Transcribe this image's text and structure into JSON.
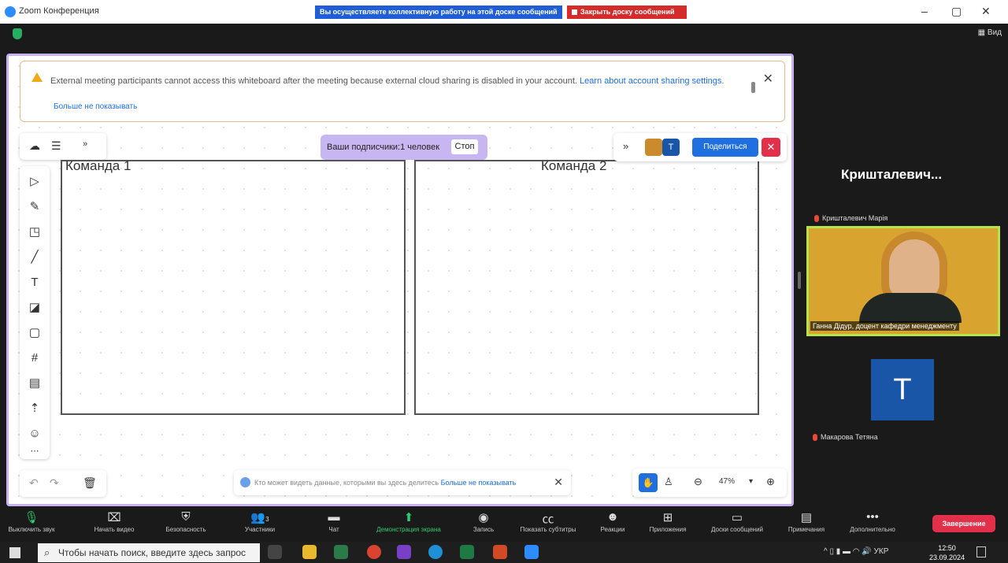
{
  "window": {
    "title": "Zoom Конференция",
    "collab_banner": "Вы осуществляете коллективную работу на этой доске сообщений",
    "close_board": "Закрыть доску сообщений",
    "view_label": "Вид"
  },
  "notice": {
    "message": "External meeting participants cannot access this whiteboard after the meeting because external cloud sharing is disabled in your account.",
    "link": "Learn about account sharing settings.",
    "dont_show": "Больше не показывать"
  },
  "board": {
    "frame1": "Команда 1",
    "frame2": "Команда 2",
    "subscribers": "Ваши подписчики:1 человек",
    "stop": "Стоп",
    "share": "Поделиться",
    "avatar_t": "T",
    "privacy_text": "Кто может видеть данные, которыми вы здесь делитесь",
    "privacy_link": "Больше не показывать",
    "zoom_level": "47%"
  },
  "participants": {
    "speaker_big": "Кришталевич...",
    "speaker_sub": "Кришталевич Марія",
    "video_caption": "Ганна Дідур, доцент кафедри менеджменту",
    "avatar_letter": "T",
    "third_name": "Макарова Тетяна"
  },
  "toolbar": {
    "mute": "Выключить звук",
    "video": "Начать видео",
    "security": "Безопасность",
    "participants": "Участники",
    "participants_count": "3",
    "chat": "Чат",
    "share_screen": "Демонстрация экрана",
    "record": "Запись",
    "captions": "Показать субтитры",
    "reactions": "Реакции",
    "apps": "Приложения",
    "whiteboards": "Доски сообщений",
    "notes": "Примечания",
    "more": "Дополнительно",
    "end": "Завершение"
  },
  "taskbar": {
    "search_placeholder": "Чтобы начать поиск, введите здесь запрос",
    "lang": "УКР",
    "time": "12:50",
    "date": "23.09.2024"
  }
}
